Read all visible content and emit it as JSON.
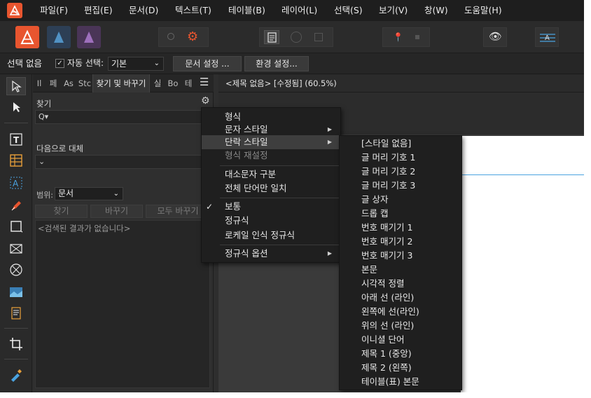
{
  "menubar": {
    "items": [
      "파일(F)",
      "편집(E)",
      "문서(D)",
      "텍스트(T)",
      "테이블(B)",
      "레이어(L)",
      "선택(S)",
      "보기(V)",
      "창(W)",
      "도움말(H)"
    ]
  },
  "context": {
    "selection_label": "선택 없음",
    "auto_select_label": "자동 선택:",
    "auto_select_checked": true,
    "auto_select_value": "기본",
    "doc_setup_label": "문서 설정 ...",
    "prefs_label": "환경 설정..."
  },
  "panel": {
    "tabs": [
      "Il",
      "페",
      "As",
      "Stc",
      "찾기 및 바꾸기",
      "실",
      "Bo",
      "테"
    ],
    "active_tab": "찾기 및 바꾸기",
    "find_label": "찾기",
    "find_value": "Q▾",
    "replace_label": "다음으로 대체",
    "replace_value": "⌄",
    "scope_label": "범위:",
    "scope_value": "문서",
    "find_button": "찾기",
    "replace_button": "바꾸기",
    "replace_all_button": "모두 바꾸기",
    "results_text": "<검색된 결과가 없습니다>"
  },
  "document": {
    "title": "<제목 없음> [수정됨] (60.5%)"
  },
  "context_menu": {
    "items": [
      {
        "label": "형식"
      },
      {
        "label": "문자 스타일",
        "submenu": true
      },
      {
        "label": "단락 스타일",
        "submenu": true,
        "highlighted": true
      },
      {
        "label": "형식 재설정",
        "disabled": true
      },
      {
        "label": "대소문자 구분"
      },
      {
        "label": "전체 단어만 일치"
      },
      {
        "label": "보통",
        "checked": true
      },
      {
        "label": "정규식"
      },
      {
        "label": "로케일 인식 정규식"
      },
      {
        "label": "정규식 옵션",
        "submenu": true
      }
    ]
  },
  "paragraph_styles_menu": {
    "items": [
      "[스타일 없음]",
      "글 머리 기호 1",
      "글 머리 기호 2",
      "글 머리 기호 3",
      "글 상자",
      "드롭 캡",
      "번호 매기기 1",
      "번호 매기기 2",
      "번호 매기기 3",
      "본문",
      "시각적 정렬",
      "아래 선 (라인)",
      "왼쪽에 선(라인)",
      "위의 선 (라인)",
      "이니셜 단어",
      "제목 1 (중앙)",
      "제목 2 (왼쪽)",
      "테이블(표) 본문"
    ]
  },
  "colors": {
    "accent": "#e8552f",
    "highlight": "#3e3e3e",
    "page_guide": "#4aa3e0"
  }
}
